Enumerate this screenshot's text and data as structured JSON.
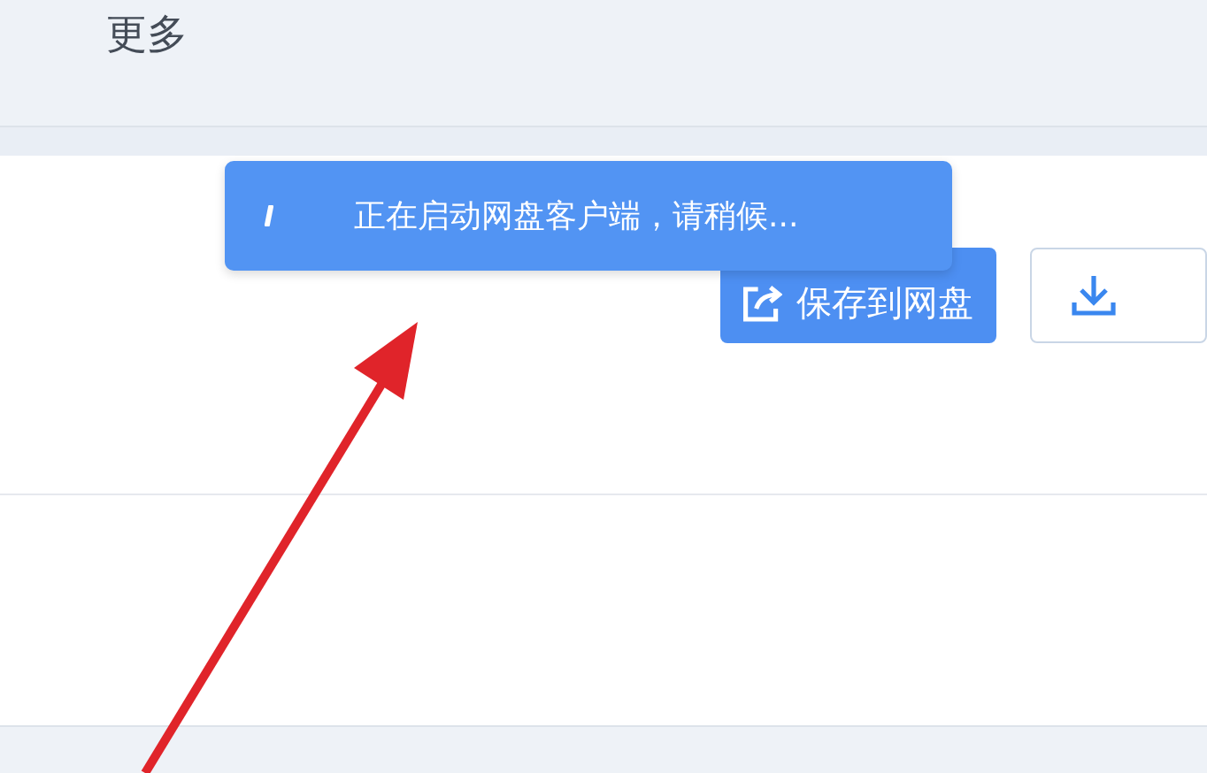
{
  "top_bar": {
    "menu_label": "更多"
  },
  "actions": {
    "save_button": "保存到网盘"
  },
  "toast": {
    "message": "正在启动网盘客户端，请稍候..."
  }
}
